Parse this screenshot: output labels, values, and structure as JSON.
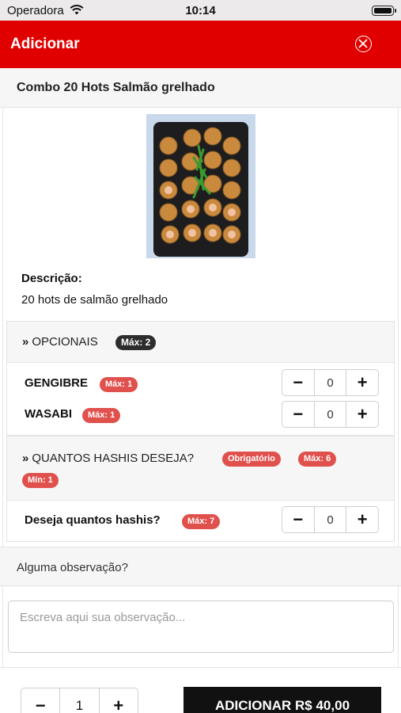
{
  "status_bar": {
    "carrier": "Operadora",
    "time": "10:14"
  },
  "header": {
    "title": "Adicionar"
  },
  "product": {
    "title": "Combo 20 Hots Salmão grelhado",
    "description_label": "Descrição:",
    "description": "20 hots de salmão grelhado"
  },
  "opcionais": {
    "title": "OPCIONAIS",
    "max_badge": "Máx: 2",
    "items": [
      {
        "label": "GENGIBRE",
        "badge": "Máx: 1",
        "value": "0"
      },
      {
        "label": "WASABI",
        "badge": "Máx: 1",
        "value": "0"
      }
    ]
  },
  "hashis": {
    "title": "QUANTOS HASHIS DESEJA?",
    "badges": [
      "Obrigatório",
      "Máx: 6",
      "Mín: 1"
    ],
    "item": {
      "label": "Deseja quantos hashis?",
      "badge": "Máx: 7",
      "value": "0"
    }
  },
  "observation": {
    "title": "Alguma observação?",
    "placeholder": "Escreva aqui sua observação..."
  },
  "footer": {
    "quantity": "1",
    "add_button": "ADICIONAR R$ 40,00"
  },
  "icons": {
    "minus": "−",
    "plus": "+",
    "chevron": "»"
  },
  "colors": {
    "header": "#e10000",
    "badge_red": "#e0504c",
    "badge_dark": "#2d2d2d",
    "button": "#111111"
  }
}
